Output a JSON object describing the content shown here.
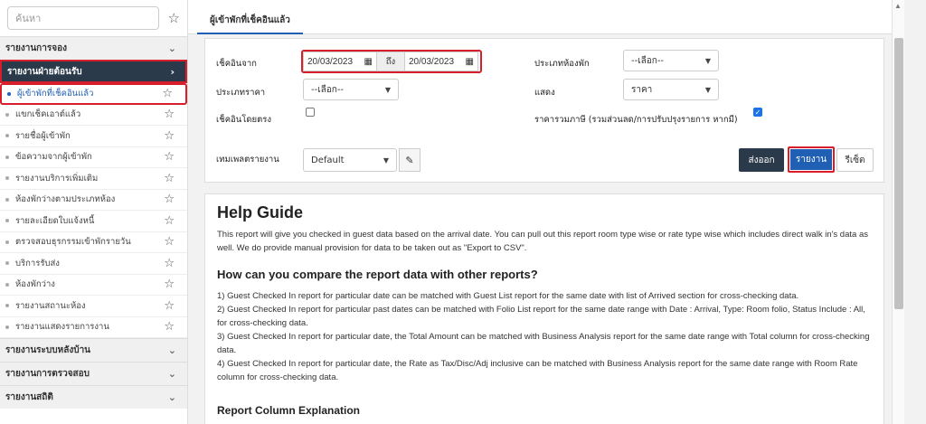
{
  "sidebar": {
    "search_placeholder": "ค้นหา",
    "sections": [
      {
        "label": "รายงานการจอง"
      },
      {
        "label": "รายงานฝ่ายต้อนรับ"
      }
    ],
    "items": [
      {
        "label": "ผู้เข้าพักที่เช็คอินแล้ว"
      },
      {
        "label": "แขกเช็คเอาต์แล้ว"
      },
      {
        "label": "รายชื่อผู้เข้าพัก"
      },
      {
        "label": "ข้อความจากผู้เข้าพัก"
      },
      {
        "label": "รายงานบริการเพิ่มเติม"
      },
      {
        "label": "ห้องพักว่างตามประเภทห้อง"
      },
      {
        "label": "รายละเอียดใบแจ้งหนี้"
      },
      {
        "label": "ตรวจสอบธุรกรรมเข้าพักรายวัน"
      },
      {
        "label": "บริการรับส่ง"
      },
      {
        "label": "ห้องพักว่าง"
      },
      {
        "label": "รายงานสถานะห้อง"
      },
      {
        "label": "รายงานแสดงรายการงาน"
      }
    ],
    "bottom_sections": [
      {
        "label": "รายงานระบบหลังบ้าน"
      },
      {
        "label": "รายงานการตรวจสอบ"
      },
      {
        "label": "รายงานสถิติ"
      }
    ]
  },
  "tab": {
    "label": "ผู้เข้าพักที่เช็คอินแล้ว"
  },
  "form": {
    "checkin_from_label": "เช็คอินจาก",
    "date_from": "20/03/2023",
    "to_label": "ถึง",
    "date_to": "20/03/2023",
    "room_type_label": "ประเภทห้องพัก",
    "room_type_value": "--เลือก--",
    "rate_type_label": "ประเภทราคา",
    "rate_type_value": "--เลือก--",
    "show_label": "แสดง",
    "show_value": "ราคา",
    "walkin_label": "เช็คอินโดยตรง",
    "tax_inclusive_label": "ราคารวมภาษี (รวมส่วนลด/การปรับปรุงรายการ หากมี)",
    "template_label": "เทมเพลตรายงาน",
    "template_value": "Default",
    "export_label": "ส่งออก",
    "report_label": "รายงาน",
    "reset_label": "รีเซ็ต"
  },
  "guide": {
    "title": "Help Guide",
    "intro": "This report will give you checked in guest data based on the arrival date. You can pull out this report room type wise or rate type wise which includes direct walk in's data as well. We do provide manual provision for data to be taken out as \"Export to CSV\".",
    "compare_heading": "How can you compare the report data with other reports?",
    "points": [
      "1) Guest Checked In report for particular date can be matched with Guest List report for the same date with list of Arrived section for cross-checking data.",
      "2) Guest Checked In report for particular past dates can be matched with Folio List report for the same date range with Date : Arrival, Type: Room folio, Status Include : All, for cross-checking data.",
      "3) Guest Checked In report for particular date, the Total Amount can be matched with Business Analysis report for the same date range with Total column for cross-checking data.",
      "4) Guest Checked In report for particular date, the Rate as Tax/Disc/Adj inclusive can be matched with Business Analysis report for the same date range with Room Rate column for cross-checking data."
    ],
    "column_heading": "Report Column Explanation"
  }
}
